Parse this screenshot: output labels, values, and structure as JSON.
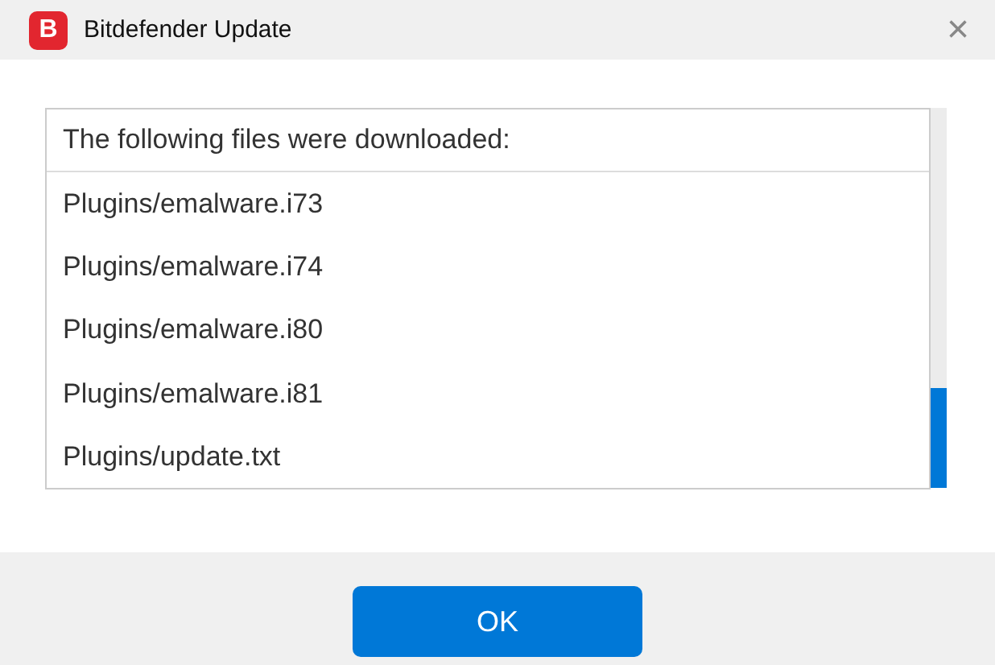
{
  "window": {
    "logo": "B",
    "title": "Bitdefender Update",
    "close": "×"
  },
  "list": {
    "header": "The following files were downloaded:",
    "items": [
      "Plugins/emalware.i73",
      "Plugins/emalware.i74",
      "Plugins/emalware.i80",
      "Plugins/emalware.i81",
      "Plugins/update.txt"
    ]
  },
  "buttons": [
    "OK"
  ]
}
